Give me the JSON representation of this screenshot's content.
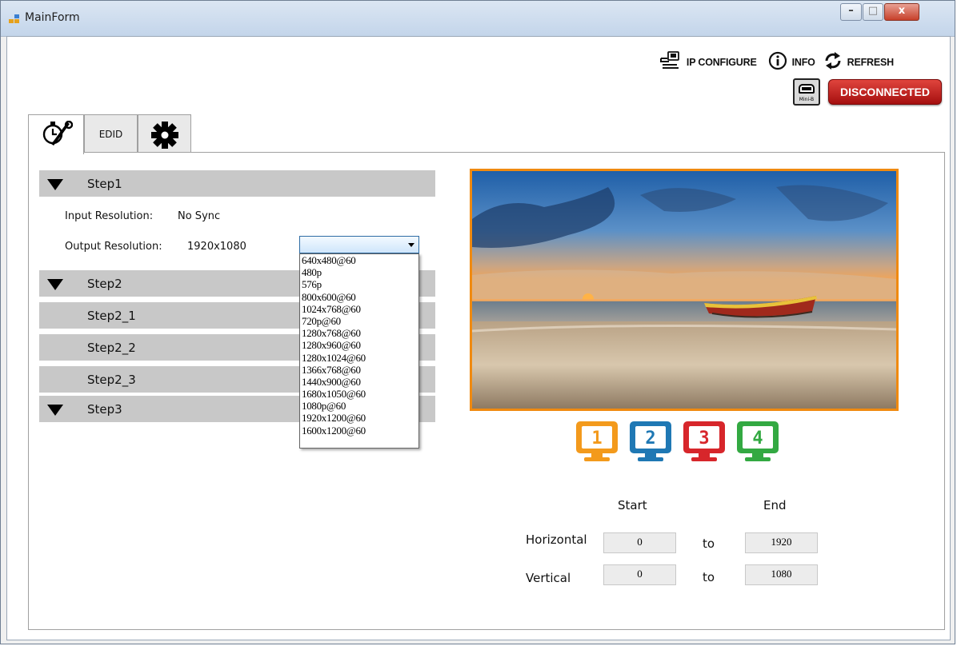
{
  "window": {
    "title": "MainForm",
    "minimize": "–",
    "maximize": "□",
    "close": "x"
  },
  "toolbar": {
    "ip_configure": {
      "icon": "network-cable-icon",
      "label": "IP CONFIGURE"
    },
    "info": {
      "icon": "info-icon",
      "label": "INFO"
    },
    "refresh": {
      "icon": "refresh-icon",
      "label": "REFRESH"
    }
  },
  "status": {
    "usb_icon": "mini-b-usb-icon",
    "usb_text": "Mini-B",
    "connection": "DISCONNECTED",
    "connection_color": "#c0171a"
  },
  "tabs": [
    {
      "icon": "stopwatch-wrench-icon",
      "label": "",
      "active": true
    },
    {
      "icon": "",
      "label": "EDID",
      "active": false
    },
    {
      "icon": "gear-icon",
      "label": "",
      "active": false
    }
  ],
  "steps": {
    "step1": {
      "label": "Step1",
      "input_resolution_label": "Input Resolution:",
      "input_resolution_value": "No Sync",
      "output_resolution_label": "Output Resolution:",
      "output_resolution_value": "1920x1080",
      "dropdown_selected": "",
      "dropdown_options": [
        "640x480@60",
        "480p",
        "576p",
        "800x600@60",
        "1024x768@60",
        "720p@60",
        "1280x768@60",
        "1280x960@60",
        "1280x1024@60",
        "1366x768@60",
        "1440x900@60",
        "1680x1050@60",
        "1080p@60",
        "1920x1200@60",
        "1600x1200@60"
      ]
    },
    "step2": {
      "label": "Step2",
      "sub": [
        "Step2_1",
        "Step2_2",
        "Step2_3"
      ]
    },
    "step3": {
      "label": "Step3"
    }
  },
  "outputs": [
    {
      "num": "1",
      "color": "#f39a1c"
    },
    {
      "num": "2",
      "color": "#1f78b4"
    },
    {
      "num": "3",
      "color": "#d7262b"
    },
    {
      "num": "4",
      "color": "#33a942"
    }
  ],
  "region": {
    "start_label": "Start",
    "end_label": "End",
    "horizontal_label": "Horizontal",
    "vertical_label": "Vertical",
    "to_label": "to",
    "h_start": "0",
    "h_end": "1920",
    "v_start": "0",
    "v_end": "1080"
  },
  "preview": {
    "border_color": "#f08a10"
  }
}
